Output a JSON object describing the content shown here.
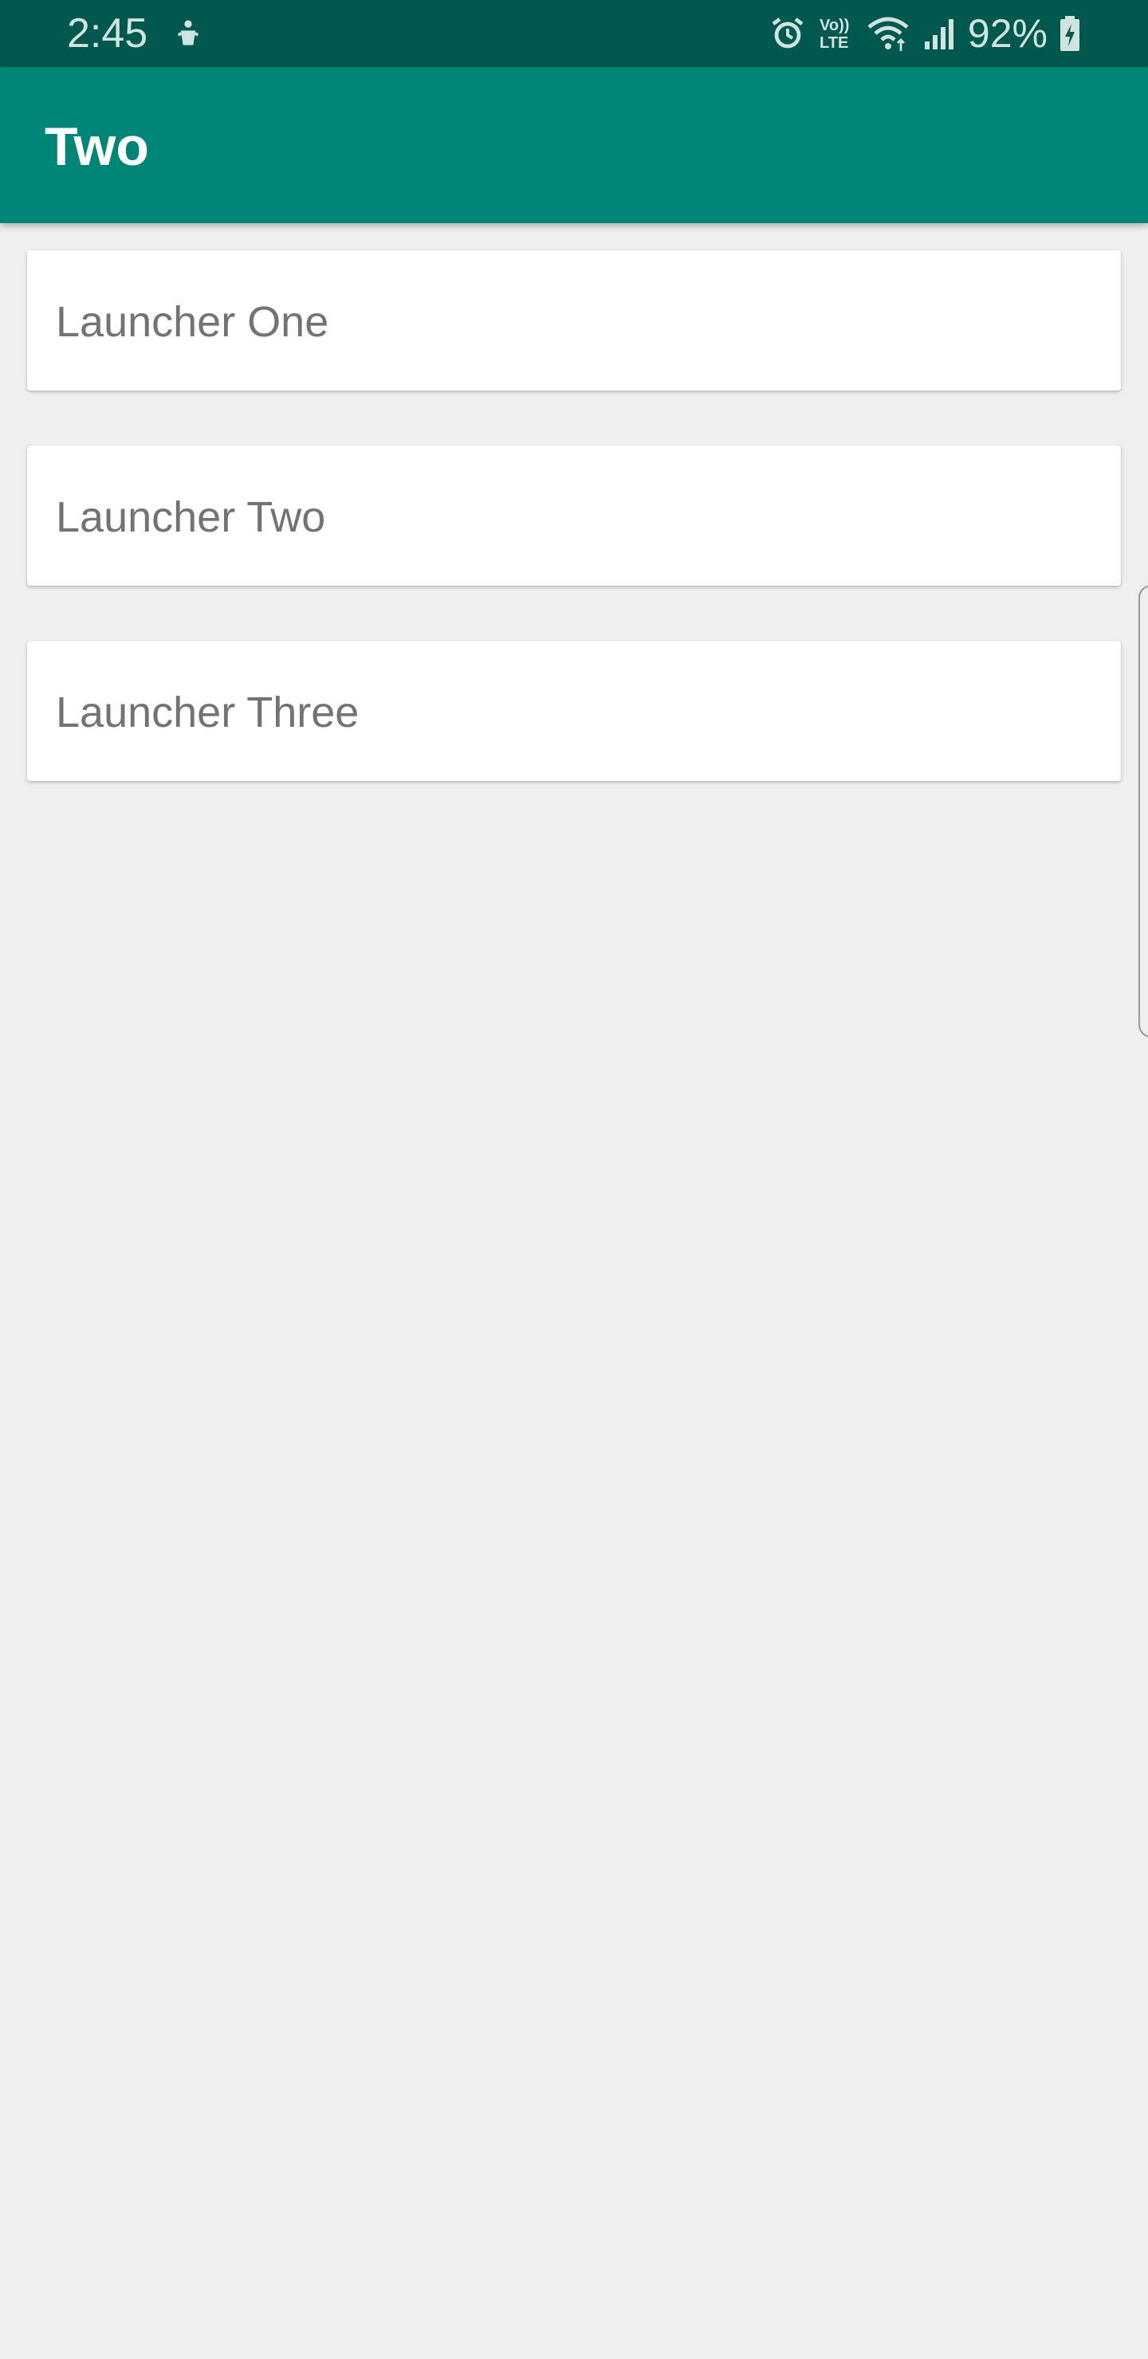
{
  "status_bar": {
    "time": "2:45",
    "battery_percent": "92%",
    "icons": [
      "android-debug-icon",
      "alarm-icon",
      "volte-icon",
      "wifi-icon",
      "signal-icon",
      "battery-charging-icon"
    ],
    "volte_label_top": "Vo))",
    "volte_label_bottom": "LTE"
  },
  "app_bar": {
    "title": "Two",
    "color": "#008577",
    "status_color": "#00574d"
  },
  "launchers": [
    {
      "label": "Launcher One"
    },
    {
      "label": "Launcher Two"
    },
    {
      "label": "Launcher Three"
    }
  ]
}
